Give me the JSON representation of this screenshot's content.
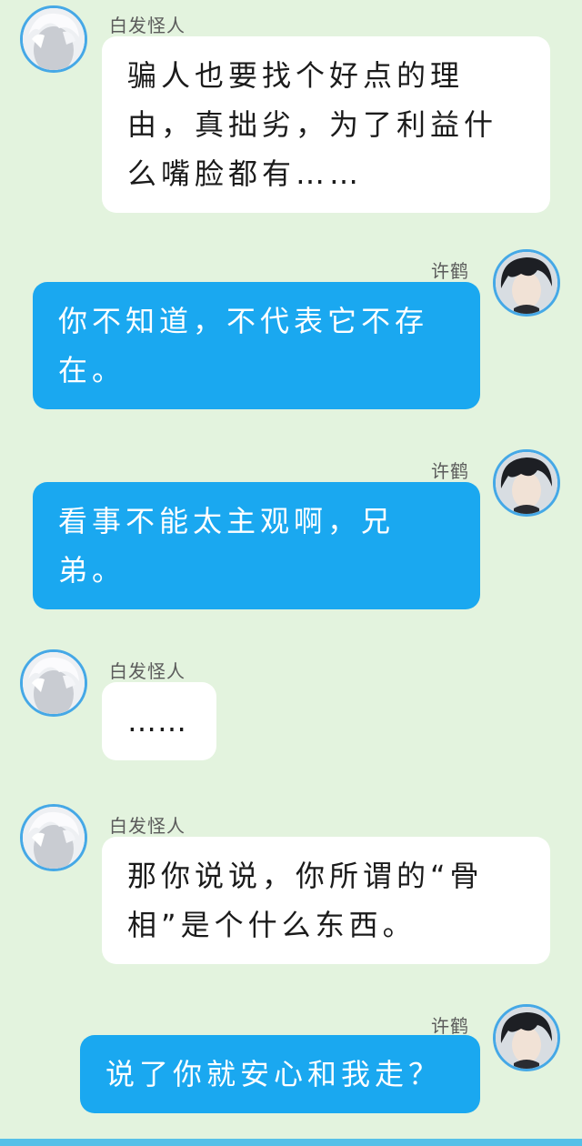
{
  "colors": {
    "background": "#e3f3de",
    "left_bubble": "#ffffff",
    "right_bubble": "#1aa8f0",
    "avatar_ring": "#45a8e6",
    "bottom_bar": "#56c0e8"
  },
  "contacts": {
    "other": {
      "name": "白发怪人",
      "avatar_icon": "white-hair-avatar-icon"
    },
    "self": {
      "name": "许鹤",
      "avatar_icon": "dark-hair-avatar-icon"
    }
  },
  "messages": [
    {
      "sender": "白发怪人",
      "side": "left",
      "text": "骗人也要找个好点的理由，真拙劣，为了利益什么嘴脸都有……"
    },
    {
      "sender": "许鹤",
      "side": "right",
      "text": "你不知道，不代表它不存在。"
    },
    {
      "sender": "许鹤",
      "side": "right",
      "text": "看事不能太主观啊，兄弟。"
    },
    {
      "sender": "白发怪人",
      "side": "left",
      "text": "……"
    },
    {
      "sender": "白发怪人",
      "side": "left",
      "text": "那你说说，你所谓的“骨相”是个什么东西。"
    },
    {
      "sender": "许鹤",
      "side": "right",
      "text": "说了你就安心和我走？"
    }
  ]
}
